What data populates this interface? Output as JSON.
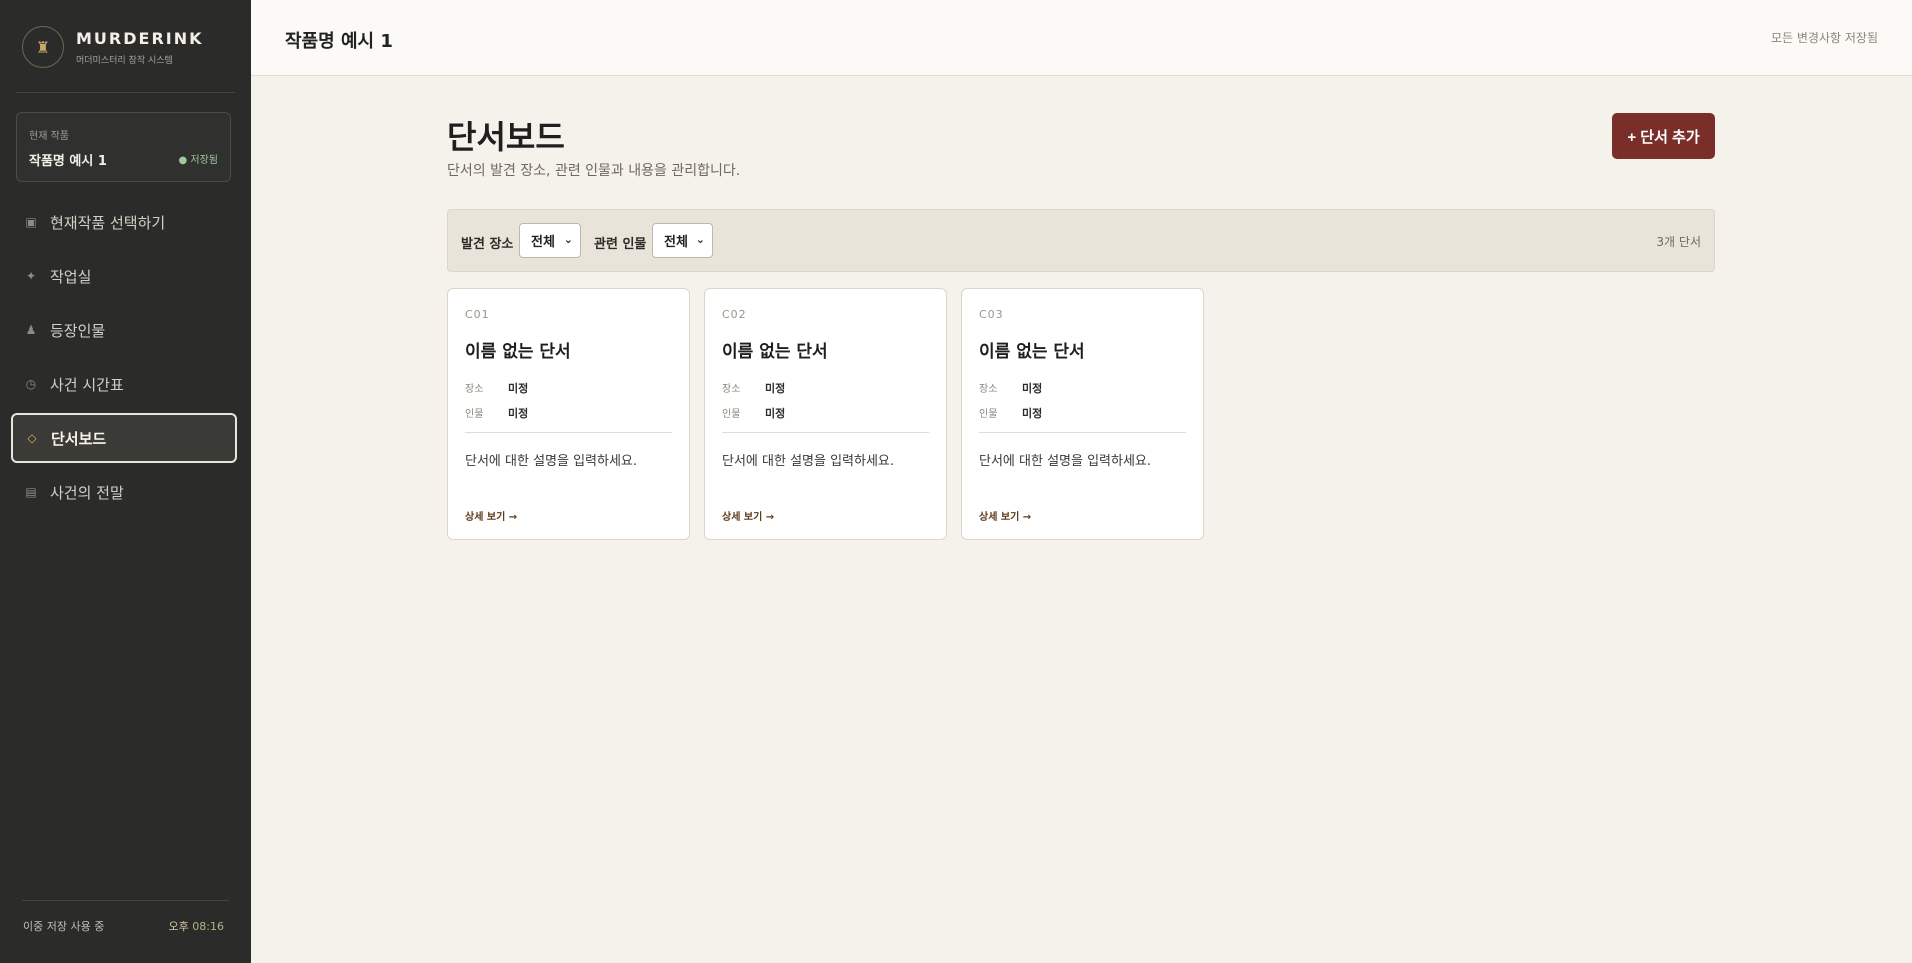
{
  "brand": {
    "title": "MURDERINK",
    "subtitle": "머더미스터리 창작 시스템",
    "logo_icon": "♜"
  },
  "current_work": {
    "label": "현재 작품",
    "name": "작품명 예시 1",
    "status": "● 저장됨"
  },
  "nav": [
    {
      "icon": "▣",
      "label": "현재작품 선택하기"
    },
    {
      "icon": "✦",
      "label": "작업실"
    },
    {
      "icon": "♟",
      "label": "등장인물"
    },
    {
      "icon": "◷",
      "label": "사건 시간표"
    },
    {
      "icon": "◇",
      "label": "단서보드"
    },
    {
      "icon": "▤",
      "label": "사건의 전말"
    }
  ],
  "footer": {
    "save_mode": "이중 저장 사용 중",
    "time_prefix": "오후",
    "time": "08:16"
  },
  "topbar": {
    "title": "작품명 예시 1",
    "status": "모든 변경사항 저장됨"
  },
  "page": {
    "title": "단서보드",
    "description": "단서의 발견 장소, 관련 인물과 내용을 관리합니다.",
    "add_button": "+ 단서 추가"
  },
  "filters": {
    "location_label": "발견 장소",
    "location_value": "전체",
    "person_label": "관련 인물",
    "person_value": "전체",
    "count": "3개 단서"
  },
  "cards": [
    {
      "code": "C01",
      "title": "이름 없는 단서",
      "place_key": "장소",
      "place": "미정",
      "person_key": "인물",
      "person": "미정",
      "desc": "단서에 대한 설명을 입력하세요.",
      "link": "상세 보기 →"
    },
    {
      "code": "C02",
      "title": "이름 없는 단서",
      "place_key": "장소",
      "place": "미정",
      "person_key": "인물",
      "person": "미정",
      "desc": "단서에 대한 설명을 입력하세요.",
      "link": "상세 보기 →"
    },
    {
      "code": "C03",
      "title": "이름 없는 단서",
      "place_key": "장소",
      "place": "미정",
      "person_key": "인물",
      "person": "미정",
      "desc": "단서에 대한 설명을 입력하세요.",
      "link": "상세 보기 →"
    }
  ],
  "colors": {
    "sidebar": "#2b2c2a",
    "accent": "#7a2e2a",
    "background": "#f5f2ec"
  }
}
